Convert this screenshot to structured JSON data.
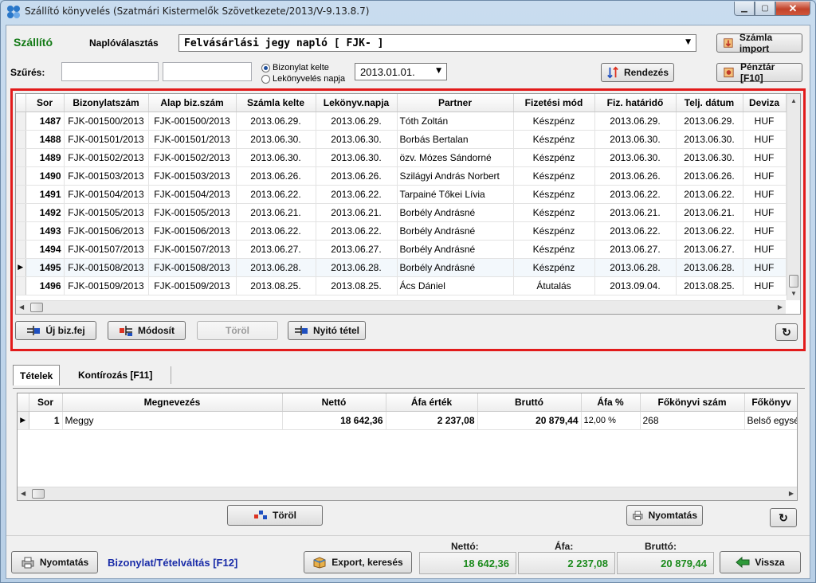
{
  "window": {
    "title": "Szállító könyvelés (Szatmári Kistermelők Szövetkezete/2013/V-9.13.8.7)"
  },
  "header": {
    "section_label": "Szállító",
    "journal_label": "Naplóválasztás",
    "journal_value": "Felvásárlási jegy napló [ FJK- ]",
    "invoice_import_button": "Számla import"
  },
  "filter": {
    "label": "Szűrés:",
    "input1_value": "",
    "input2_value": "",
    "radio_options": [
      {
        "label": "Bizonylat kelte",
        "selected": true
      },
      {
        "label": "Lekönyvelés napja",
        "selected": false
      }
    ],
    "date_value": "2013.01.01.",
    "sort_button": "Rendezés",
    "cashier_button": "Pénztár [F10]"
  },
  "documents": {
    "columns": [
      "Sor",
      "Bizonylatszám",
      "Alap biz.szám",
      "Számla kelte",
      "Lekönyv.napja",
      "Partner",
      "Fizetési mód",
      "Fiz. határidő",
      "Telj. dátum",
      "Deviza"
    ],
    "rows": [
      {
        "sor": "1487",
        "biz": "FJK-001500/2013",
        "alap": "FJK-001500/2013",
        "kelte": "2013.06.29.",
        "lekonyv": "2013.06.29.",
        "partner": "Tóth Zoltán",
        "fizmod": "Készpénz",
        "hatarido": "2013.06.29.",
        "telj": "2013.06.29.",
        "deviza": "HUF",
        "selected": false
      },
      {
        "sor": "1488",
        "biz": "FJK-001501/2013",
        "alap": "FJK-001501/2013",
        "kelte": "2013.06.30.",
        "lekonyv": "2013.06.30.",
        "partner": "Borbás Bertalan",
        "fizmod": "Készpénz",
        "hatarido": "2013.06.30.",
        "telj": "2013.06.30.",
        "deviza": "HUF",
        "selected": false
      },
      {
        "sor": "1489",
        "biz": "FJK-001502/2013",
        "alap": "FJK-001502/2013",
        "kelte": "2013.06.30.",
        "lekonyv": "2013.06.30.",
        "partner": "özv. Mózes Sándorné",
        "fizmod": "Készpénz",
        "hatarido": "2013.06.30.",
        "telj": "2013.06.30.",
        "deviza": "HUF",
        "selected": false
      },
      {
        "sor": "1490",
        "biz": "FJK-001503/2013",
        "alap": "FJK-001503/2013",
        "kelte": "2013.06.26.",
        "lekonyv": "2013.06.26.",
        "partner": "Szilágyi András Norbert",
        "fizmod": "Készpénz",
        "hatarido": "2013.06.26.",
        "telj": "2013.06.26.",
        "deviza": "HUF",
        "selected": false
      },
      {
        "sor": "1491",
        "biz": "FJK-001504/2013",
        "alap": "FJK-001504/2013",
        "kelte": "2013.06.22.",
        "lekonyv": "2013.06.22.",
        "partner": "Tarpainé Tőkei Lívia",
        "fizmod": "Készpénz",
        "hatarido": "2013.06.22.",
        "telj": "2013.06.22.",
        "deviza": "HUF",
        "selected": false
      },
      {
        "sor": "1492",
        "biz": "FJK-001505/2013",
        "alap": "FJK-001505/2013",
        "kelte": "2013.06.21.",
        "lekonyv": "2013.06.21.",
        "partner": "Borbély Andrásné",
        "fizmod": "Készpénz",
        "hatarido": "2013.06.21.",
        "telj": "2013.06.21.",
        "deviza": "HUF",
        "selected": false
      },
      {
        "sor": "1493",
        "biz": "FJK-001506/2013",
        "alap": "FJK-001506/2013",
        "kelte": "2013.06.22.",
        "lekonyv": "2013.06.22.",
        "partner": "Borbély Andrásné",
        "fizmod": "Készpénz",
        "hatarido": "2013.06.22.",
        "telj": "2013.06.22.",
        "deviza": "HUF",
        "selected": false
      },
      {
        "sor": "1494",
        "biz": "FJK-001507/2013",
        "alap": "FJK-001507/2013",
        "kelte": "2013.06.27.",
        "lekonyv": "2013.06.27.",
        "partner": "Borbély Andrásné",
        "fizmod": "Készpénz",
        "hatarido": "2013.06.27.",
        "telj": "2013.06.27.",
        "deviza": "HUF",
        "selected": false
      },
      {
        "sor": "1495",
        "biz": "FJK-001508/2013",
        "alap": "FJK-001508/2013",
        "kelte": "2013.06.28.",
        "lekonyv": "2013.06.28.",
        "partner": "Borbély Andrásné",
        "fizmod": "Készpénz",
        "hatarido": "2013.06.28.",
        "telj": "2013.06.28.",
        "deviza": "HUF",
        "selected": true
      },
      {
        "sor": "1496",
        "biz": "FJK-001509/2013",
        "alap": "FJK-001509/2013",
        "kelte": "2013.08.25.",
        "lekonyv": "2013.08.25.",
        "partner": "Ács Dániel",
        "fizmod": "Átutalás",
        "hatarido": "2013.09.04.",
        "telj": "2013.08.25.",
        "deviza": "HUF",
        "selected": false
      }
    ],
    "buttons": {
      "new": "Új biz.fej",
      "modify": "Módosít",
      "delete": "Töröl",
      "opening": "Nyitó tétel"
    }
  },
  "tabs": [
    {
      "label": "Tételek",
      "active": true
    },
    {
      "label": "Kontírozás [F11]",
      "active": false
    }
  ],
  "items": {
    "columns": [
      "Sor",
      "Megnevezés",
      "Nettó",
      "Áfa érték",
      "Bruttó",
      "Áfa %",
      "Főkönyvi szám",
      "Főkönyv"
    ],
    "rows": [
      {
        "sor": "1",
        "nev": "Meggy",
        "netto": "18 642,36",
        "afa": "2 237,08",
        "brutto": "20 879,44",
        "afa_pct": "12,00 %",
        "fokonyv_szam": "268",
        "fokonyv": "Belső egysé"
      }
    ],
    "buttons": {
      "delete": "Töröl",
      "print": "Nyomtatás"
    }
  },
  "footer": {
    "print_button": "Nyomtatás",
    "switch_link": "Bizonylat/Tételváltás [F12]",
    "export_button": "Export, keresés",
    "netto_label": "Nettó:",
    "afa_label": "Áfa:",
    "brutto_label": "Bruttó:",
    "netto_value": "18 642,36",
    "afa_value": "2 237,08",
    "brutto_value": "20 879,44",
    "back_button": "Vissza"
  }
}
